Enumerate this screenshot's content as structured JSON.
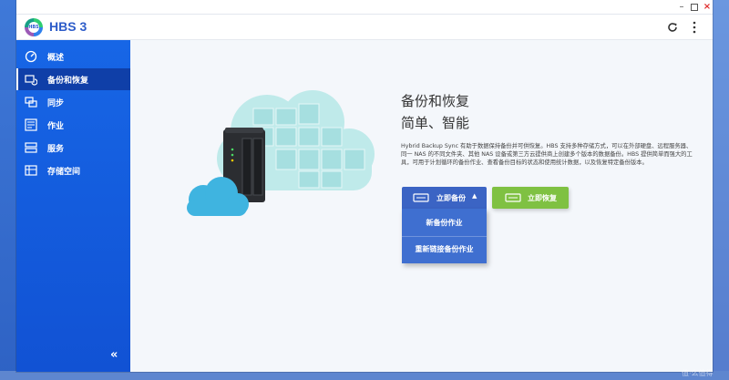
{
  "app": {
    "title": "HBS 3"
  },
  "sidebar": {
    "items": [
      {
        "label": "概述",
        "icon": "dashboard-icon",
        "active": false
      },
      {
        "label": "备份和恢复",
        "icon": "backup-restore-icon",
        "active": true
      },
      {
        "label": "同步",
        "icon": "sync-icon",
        "active": false
      },
      {
        "label": "作业",
        "icon": "jobs-icon",
        "active": false
      },
      {
        "label": "服务",
        "icon": "services-icon",
        "active": false
      },
      {
        "label": "存储空间",
        "icon": "storage-icon",
        "active": false
      }
    ],
    "collapse_glyph": "«"
  },
  "main": {
    "title": "备份和恢复",
    "subtitle": "简单、智能",
    "description": "Hybrid Backup Sync 有助于数据保持备份并可供恢复。HBS 支持多种存储方式，可以在外部硬盘、远程服务器、同一 NAS 的不同文件夹、其他 NAS 设备或第三方云提供商上创建多个版本的数据备份。HBS 提供简单而强大的工具，可用于计划循环的备份作业、查看备份目标的状态和使用统计数据，以及恢复特定备份版本。",
    "backup_button": {
      "label": "立即备份",
      "caret": "▲"
    },
    "backup_menu": [
      "新备份作业",
      "重新链接备份作业"
    ],
    "restore_button": {
      "label": "立即恢复"
    }
  },
  "colors": {
    "sidebar": "#1766e6",
    "sidebar_active": "#0f3fa8",
    "backup_button": "#3b64c4",
    "restore_button": "#7fc142",
    "title_blue": "#2d5cc9"
  },
  "watermark": "值·么值得"
}
